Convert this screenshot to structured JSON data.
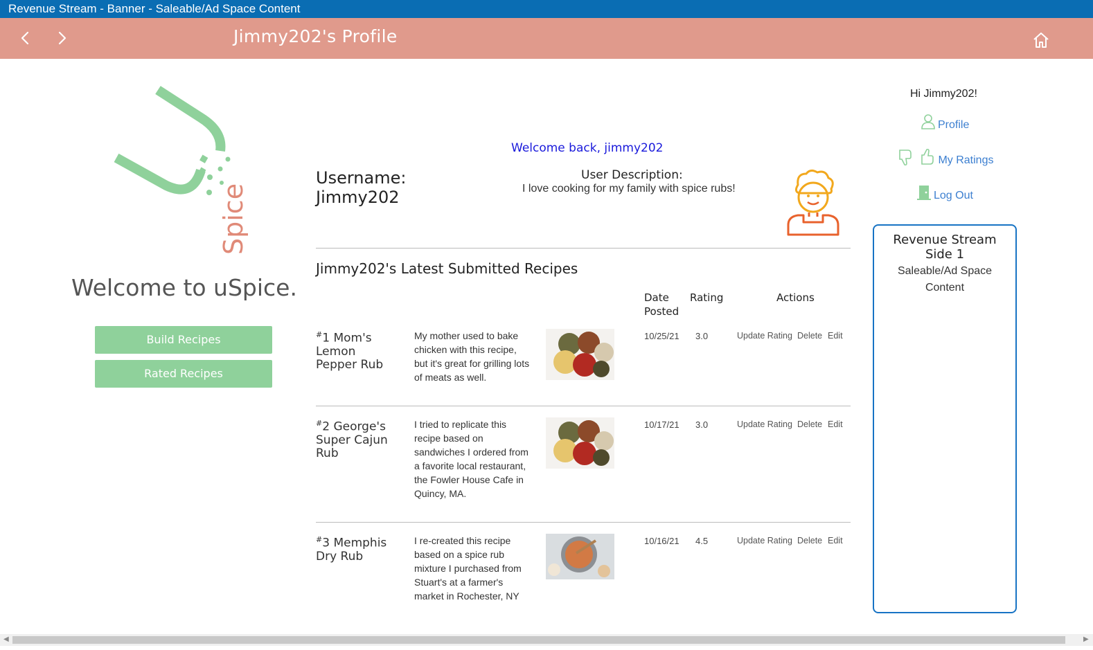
{
  "banner": {
    "text": "Revenue Stream - Banner - Saleable/Ad Space Content"
  },
  "header": {
    "title": "Jimmy202's Profile"
  },
  "left": {
    "logo_text": "Spice",
    "welcome": "Welcome to uSpice.",
    "build_label": "Build Recipes",
    "rated_label": "Rated Recipes"
  },
  "main": {
    "welcome_back": "Welcome back, jimmy202",
    "username_label": "Username:",
    "username_value": "Jimmy202",
    "desc_label": "User Description:",
    "desc_text": "I love cooking for my family with spice rubs!",
    "section_title": "Jimmy202's Latest Submitted Recipes",
    "columns": {
      "date": "Date Posted",
      "rating": "Rating",
      "actions": "Actions"
    },
    "recipes": [
      {
        "num": "#",
        "name": "1 Mom's Lemon Pepper Rub",
        "desc": "My mother used to bake chicken with this recipe, but it's great for grilling lots of meats as well.",
        "date": "10/25/21",
        "rating": "3.0"
      },
      {
        "num": "#",
        "name": "2 George's Super Cajun Rub",
        "desc": "I tried to replicate this recipe based on sandwiches I ordered from a favorite local restaurant, the Fowler House Cafe in Quincy, MA.",
        "date": "10/17/21",
        "rating": "3.0"
      },
      {
        "num": "#",
        "name": "3 Memphis Dry Rub",
        "desc": "I re-created this recipe based on a spice rub mixture I purchased from Stuart's at a farmer's market in Rochester, NY",
        "date": "10/16/21",
        "rating": "4.5"
      }
    ],
    "actions": {
      "update": "Update Rating",
      "delete": "Delete",
      "edit": "Edit"
    }
  },
  "right": {
    "greeting": "Hi Jimmy202!",
    "profile_label": "Profile",
    "ratings_label": "My Ratings",
    "logout_label": "Log Out",
    "ad_title": "Revenue Stream Side 1",
    "ad_sub": "Saleable/Ad Space Content"
  },
  "colors": {
    "banner": "#0a6db3",
    "header": "#e09a8c",
    "button": "#8fd19b",
    "link": "#3c7fd0",
    "ad_border": "#1773c4"
  }
}
